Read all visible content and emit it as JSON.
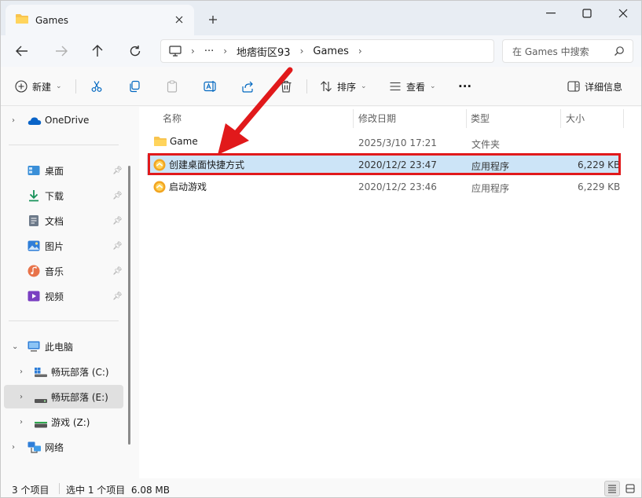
{
  "window": {
    "tab_title": "Games",
    "new_tab": "+"
  },
  "address": {
    "more": "···",
    "segments": [
      "地痞街区93",
      "Games"
    ],
    "search_placeholder": "在 Games 中搜索"
  },
  "toolbar": {
    "new_label": "新建",
    "sort_label": "排序",
    "view_label": "查看",
    "more_label": "···",
    "details_label": "详细信息"
  },
  "sidebar": {
    "onedrive": "OneDrive",
    "quick": [
      {
        "label": "桌面",
        "icon": "desktop-icon"
      },
      {
        "label": "下载",
        "icon": "download-icon"
      },
      {
        "label": "文档",
        "icon": "document-icon"
      },
      {
        "label": "图片",
        "icon": "picture-icon"
      },
      {
        "label": "音乐",
        "icon": "music-icon"
      },
      {
        "label": "视频",
        "icon": "video-icon"
      }
    ],
    "this_pc": "此电脑",
    "drives": [
      {
        "label": "畅玩部落 (C:)"
      },
      {
        "label": "畅玩部落 (E:)"
      },
      {
        "label": "游戏 (Z:)"
      }
    ],
    "network": "网络"
  },
  "columns": [
    "名称",
    "修改日期",
    "类型",
    "大小"
  ],
  "files": [
    {
      "name": "Game",
      "date": "2025/3/10 17:21",
      "type": "文件夹",
      "size": "",
      "icon": "folder-icon"
    },
    {
      "name": "创建桌面快捷方式",
      "date": "2020/12/2 23:47",
      "type": "应用程序",
      "size": "6,229 KB",
      "icon": "app-icon"
    },
    {
      "name": "启动游戏",
      "date": "2020/12/2 23:46",
      "type": "应用程序",
      "size": "6,229 KB",
      "icon": "app-icon"
    }
  ],
  "status": {
    "count": "3 个项目",
    "selection": "选中 1 个项目  6.08 MB"
  },
  "colors": {
    "accent": "#0067c0",
    "selection": "#cce4f7",
    "highlight_box": "#e1191b"
  }
}
